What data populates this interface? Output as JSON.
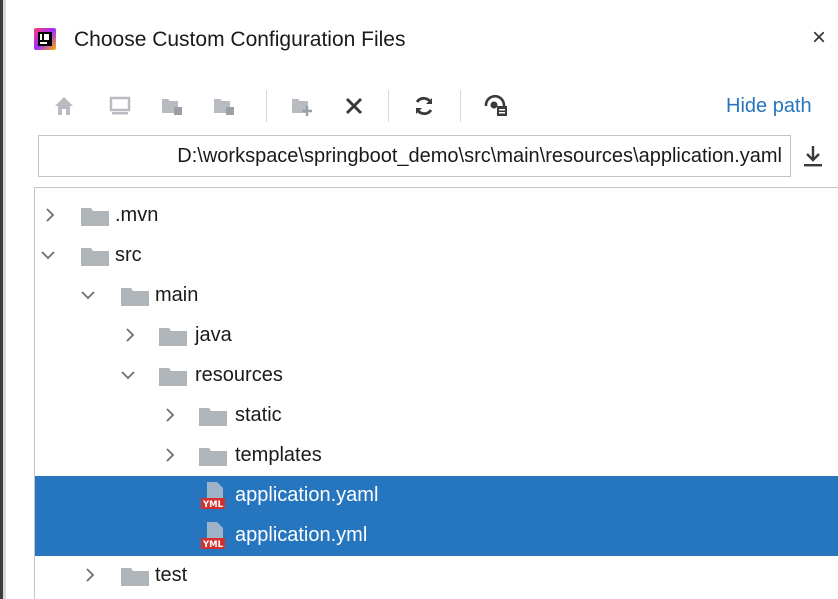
{
  "window": {
    "title": "Choose Custom Configuration Files",
    "close_label": "×"
  },
  "toolbar": {
    "buttons": [
      {
        "icon": "home-icon"
      },
      {
        "icon": "desktop-icon"
      },
      {
        "icon": "project-folder-icon"
      },
      {
        "icon": "module-folder-icon"
      },
      {
        "icon": "new-folder-icon"
      },
      {
        "icon": "delete-icon"
      },
      {
        "icon": "refresh-icon"
      },
      {
        "icon": "show-hidden-icon"
      }
    ],
    "hide_path_label": "Hide path"
  },
  "path": {
    "value": "D:\\workspace\\springboot_demo\\src\\main\\resources\\application.yaml"
  },
  "tree": {
    "items": [
      {
        "label": ".mvn",
        "type": "folder",
        "expanded": false,
        "selected": false
      },
      {
        "label": "src",
        "type": "folder",
        "expanded": true,
        "selected": false
      },
      {
        "label": "main",
        "type": "folder",
        "expanded": true,
        "selected": false
      },
      {
        "label": "java",
        "type": "folder",
        "expanded": false,
        "selected": false
      },
      {
        "label": "resources",
        "type": "folder",
        "expanded": true,
        "selected": false
      },
      {
        "label": "static",
        "type": "folder",
        "expanded": false,
        "selected": false
      },
      {
        "label": "templates",
        "type": "folder",
        "expanded": false,
        "selected": false
      },
      {
        "label": "application.yaml",
        "type": "yaml-file",
        "selected": true
      },
      {
        "label": "application.yml",
        "type": "yaml-file",
        "selected": true
      },
      {
        "label": "test",
        "type": "folder",
        "expanded": false,
        "selected": false
      }
    ]
  },
  "colors": {
    "selection": "#2675bf",
    "link": "#2675bf",
    "folder": "#b0b5b9",
    "yaml_badge": "#d33030"
  }
}
